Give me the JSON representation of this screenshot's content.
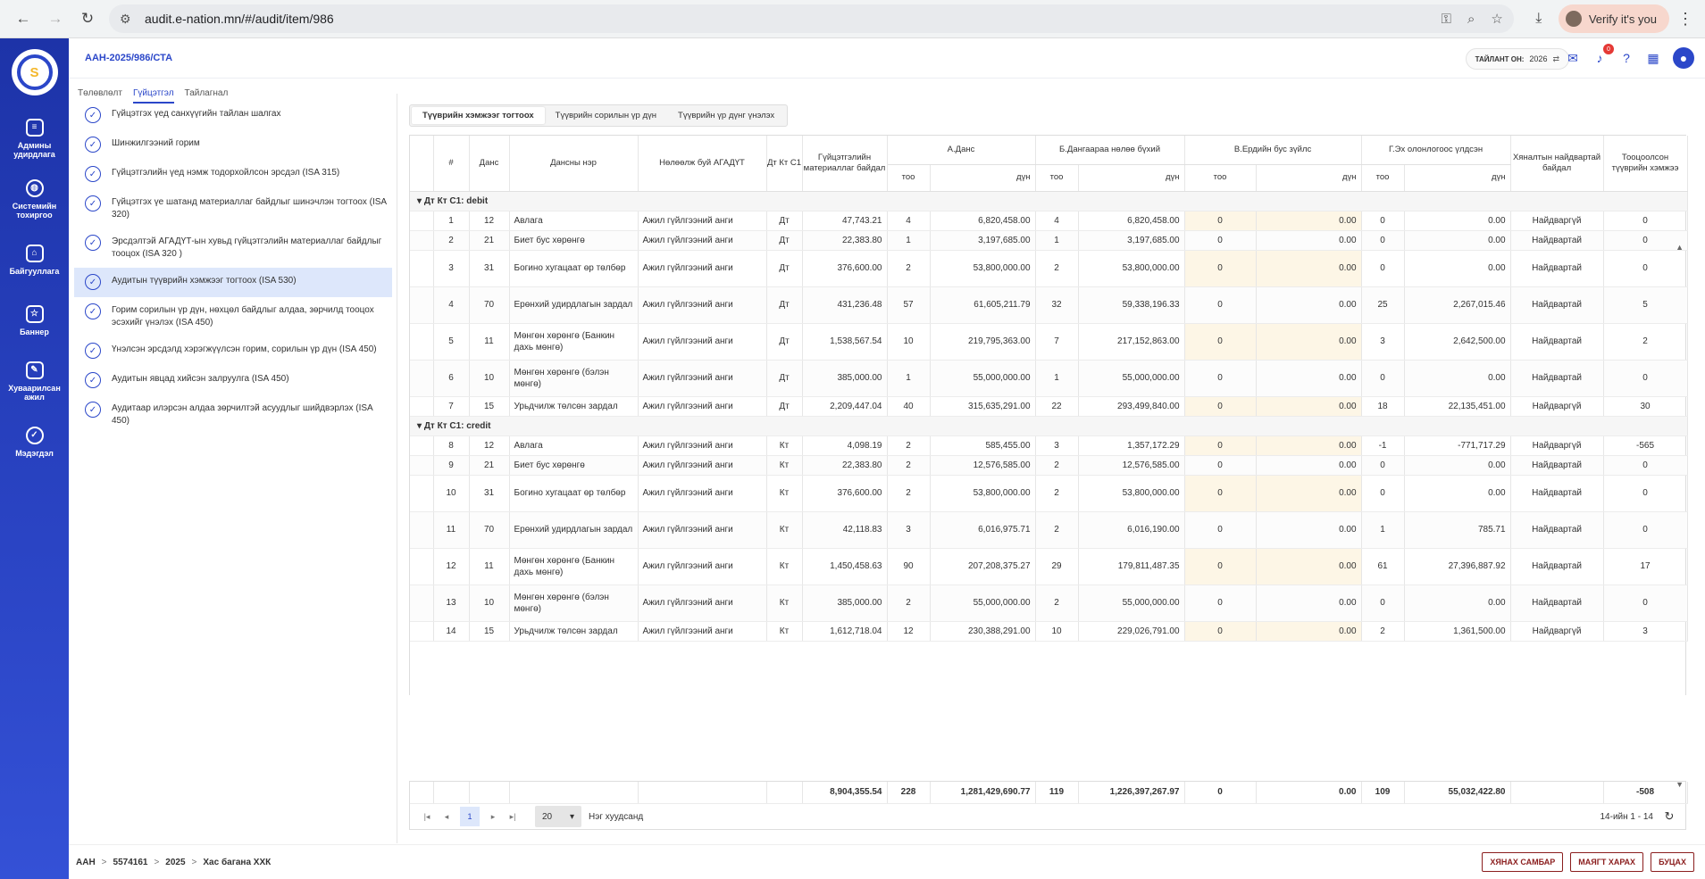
{
  "browser": {
    "url": "audit.e-nation.mn/#/audit/item/986",
    "verify_label": "Verify it's you"
  },
  "sidebar": {
    "items": [
      {
        "label": "Админы удирдлага",
        "icon": "server-icon"
      },
      {
        "label": "Системийн тохиргоо",
        "icon": "user-settings-icon"
      },
      {
        "label": "Байгууллага",
        "icon": "home-icon"
      },
      {
        "label": "Баннер",
        "icon": "star-icon"
      },
      {
        "label": "Хуваарилсан ажил",
        "icon": "task-icon"
      },
      {
        "label": "Мэдэгдэл",
        "icon": "check-circle-icon"
      }
    ]
  },
  "header": {
    "code": "ААН-2025/986/СТА",
    "year_label": "ТАЙЛАНТ ОН:",
    "year_value": "2026",
    "notif_count": "0"
  },
  "subtabs": [
    "Төлөвлөлт",
    "Гүйцэтгэл",
    "Тайлагнал"
  ],
  "steps": [
    "Гүйцэтгэх үед санхүүгийн тайлан шалгах",
    "Шинжилгээний горим",
    "Гүйцэтгэлийн үед нэмж тодорхойлсон эрсдэл (ISA 315)",
    "Гүйцэтгэх үе шатанд материаллаг байдлыг шинэчлэн тогтоох (ISA 320)",
    "Эрсдэлтэй АГАДҮТ-ын хувьд гүйцэтгэлийн материаллаг байдлыг тооцох (ISA 320 )",
    "Аудитын түүврийн хэмжээг тогтоох (ISA 530)",
    "Горим сорилын үр дүн, нөхцөл байдлыг алдаа, зөрчилд тооцох эсэхийг үнэлэх (ISA 450)",
    "Үнэлсэн эрсдэлд хэрэгжүүлсэн горим, сорилын үр дүн (ISA 450)",
    "Аудитын явцад хийсэн залруулга (ISA 450)",
    "Аудитаар илэрсэн алдаа зөрчилтэй асуудлыг шийдвэрлэх (ISA 450)"
  ],
  "segtabs": [
    "Түүврийн хэмжээг тогтоох",
    "Түүврийн сорилын үр дүн",
    "Түүврийн үр дүнг үнэлэх"
  ],
  "table": {
    "headers": {
      "num": "#",
      "acct": "Данс",
      "acct_name": "Дансны нэр",
      "agadut": "Нөлөөлж буй АГАДҮТ",
      "dtkt": "Дт Кт С1",
      "mat": "Гүйцэтгэлийн материаллаг байдал",
      "a": "А.Данс",
      "b": "Б.Дангаараа нөлөө бүхий",
      "v": "В.Ердийн бус зүйлс",
      "g": "Г.Эх олонлогоос үлдсэн",
      "too": "тоо",
      "dun": "дүн",
      "control": "Хяналтын найдвартай байдал",
      "sample": "Тооцоолсон түүврийн хэмжээ"
    },
    "groups": [
      {
        "label": "Дт Кт С1: debit",
        "rows": [
          [
            "1",
            "12",
            "Авлага",
            "Ажил гүйлгээний анги",
            "Дт",
            "47,743.21",
            "4",
            "6,820,458.00",
            "4",
            "6,820,458.00",
            "0",
            "0.00",
            "0",
            "0.00",
            "Найдваргүй",
            "0"
          ],
          [
            "2",
            "21",
            "Биет бус хөрөнгө",
            "Ажил гүйлгээний анги",
            "Дт",
            "22,383.80",
            "1",
            "3,197,685.00",
            "1",
            "3,197,685.00",
            "0",
            "0.00",
            "0",
            "0.00",
            "Найдвартай",
            "0"
          ],
          [
            "3",
            "31",
            "Богино хугацаат өр төлбөр",
            "Ажил гүйлгээний анги",
            "Дт",
            "376,600.00",
            "2",
            "53,800,000.00",
            "2",
            "53,800,000.00",
            "0",
            "0.00",
            "0",
            "0.00",
            "Найдвартай",
            "0"
          ],
          [
            "4",
            "70",
            "Ерөнхий удирдлагын зардал",
            "Ажил гүйлгээний анги",
            "Дт",
            "431,236.48",
            "57",
            "61,605,211.79",
            "32",
            "59,338,196.33",
            "0",
            "0.00",
            "25",
            "2,267,015.46",
            "Найдвартай",
            "5"
          ],
          [
            "5",
            "11",
            "Мөнгөн хөрөнгө (Банкин дахь мөнгө)",
            "Ажил гүйлгээний анги",
            "Дт",
            "1,538,567.54",
            "10",
            "219,795,363.00",
            "7",
            "217,152,863.00",
            "0",
            "0.00",
            "3",
            "2,642,500.00",
            "Найдвартай",
            "2"
          ],
          [
            "6",
            "10",
            "Мөнгөн хөрөнгө (бэлэн мөнгө)",
            "Ажил гүйлгээний анги",
            "Дт",
            "385,000.00",
            "1",
            "55,000,000.00",
            "1",
            "55,000,000.00",
            "0",
            "0.00",
            "0",
            "0.00",
            "Найдвартай",
            "0"
          ],
          [
            "7",
            "15",
            "Урьдчилж төлсөн зардал",
            "Ажил гүйлгээний анги",
            "Дт",
            "2,209,447.04",
            "40",
            "315,635,291.00",
            "22",
            "293,499,840.00",
            "0",
            "0.00",
            "18",
            "22,135,451.00",
            "Найдваргүй",
            "30"
          ]
        ]
      },
      {
        "label": "Дт Кт С1: credit",
        "rows": [
          [
            "8",
            "12",
            "Авлага",
            "Ажил гүйлгээний анги",
            "Кт",
            "4,098.19",
            "2",
            "585,455.00",
            "3",
            "1,357,172.29",
            "0",
            "0.00",
            "-1",
            "-771,717.29",
            "Найдваргүй",
            "-565"
          ],
          [
            "9",
            "21",
            "Биет бус хөрөнгө",
            "Ажил гүйлгээний анги",
            "Кт",
            "22,383.80",
            "2",
            "12,576,585.00",
            "2",
            "12,576,585.00",
            "0",
            "0.00",
            "0",
            "0.00",
            "Найдвартай",
            "0"
          ],
          [
            "10",
            "31",
            "Богино хугацаат өр төлбөр",
            "Ажил гүйлгээний анги",
            "Кт",
            "376,600.00",
            "2",
            "53,800,000.00",
            "2",
            "53,800,000.00",
            "0",
            "0.00",
            "0",
            "0.00",
            "Найдвартай",
            "0"
          ],
          [
            "11",
            "70",
            "Ерөнхий удирдлагын зардал",
            "Ажил гүйлгээний анги",
            "Кт",
            "42,118.83",
            "3",
            "6,016,975.71",
            "2",
            "6,016,190.00",
            "0",
            "0.00",
            "1",
            "785.71",
            "Найдвартай",
            "0"
          ],
          [
            "12",
            "11",
            "Мөнгөн хөрөнгө (Банкин дахь мөнгө)",
            "Ажил гүйлгээний анги",
            "Кт",
            "1,450,458.63",
            "90",
            "207,208,375.27",
            "29",
            "179,811,487.35",
            "0",
            "0.00",
            "61",
            "27,396,887.92",
            "Найдвартай",
            "17"
          ],
          [
            "13",
            "10",
            "Мөнгөн хөрөнгө (бэлэн мөнгө)",
            "Ажил гүйлгээний анги",
            "Кт",
            "385,000.00",
            "2",
            "55,000,000.00",
            "2",
            "55,000,000.00",
            "0",
            "0.00",
            "0",
            "0.00",
            "Найдвартай",
            "0"
          ],
          [
            "14",
            "15",
            "Урьдчилж төлсөн зардал",
            "Ажил гүйлгээний анги",
            "Кт",
            "1,612,718.04",
            "12",
            "230,388,291.00",
            "10",
            "229,026,791.00",
            "0",
            "0.00",
            "2",
            "1,361,500.00",
            "Найдваргүй",
            "3"
          ]
        ]
      }
    ],
    "totals": [
      "8,904,355.54",
      "228",
      "1,281,429,690.77",
      "119",
      "1,226,397,267.97",
      "0",
      "0.00",
      "109",
      "55,032,422.80",
      "-508"
    ]
  },
  "pager": {
    "page": "1",
    "size": "20",
    "size_label": "Нэг хуудсанд",
    "count": "14-ийн 1 - 14"
  },
  "footer": {
    "breadcrumb": [
      "ААН",
      "5574161",
      "2025",
      "Хас багана ХХК"
    ],
    "buttons": [
      "ХЯНАХ САМБАР",
      "МАЯГТ ХАРАХ",
      "БУЦАХ"
    ]
  }
}
